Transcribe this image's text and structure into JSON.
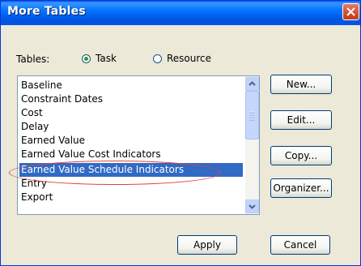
{
  "window": {
    "title": "More Tables"
  },
  "tables_label": "Tables:",
  "radio": {
    "task_label": "Task",
    "resource_label": "Resource",
    "selected": "task"
  },
  "list": {
    "items": [
      "Baseline",
      "Constraint Dates",
      "Cost",
      "Delay",
      "Earned Value",
      "Earned Value Cost Indicators",
      "Earned Value Schedule Indicators",
      "Entry",
      "Export"
    ],
    "selected": "Earned Value Schedule Indicators"
  },
  "buttons": {
    "new": "New...",
    "edit": "Edit...",
    "copy": "Copy...",
    "organizer": "Organizer...",
    "apply": "Apply",
    "cancel": "Cancel"
  },
  "colors": {
    "titlebar": "#0054e3",
    "selection": "#316ac5",
    "annotation": "#e0443a"
  }
}
